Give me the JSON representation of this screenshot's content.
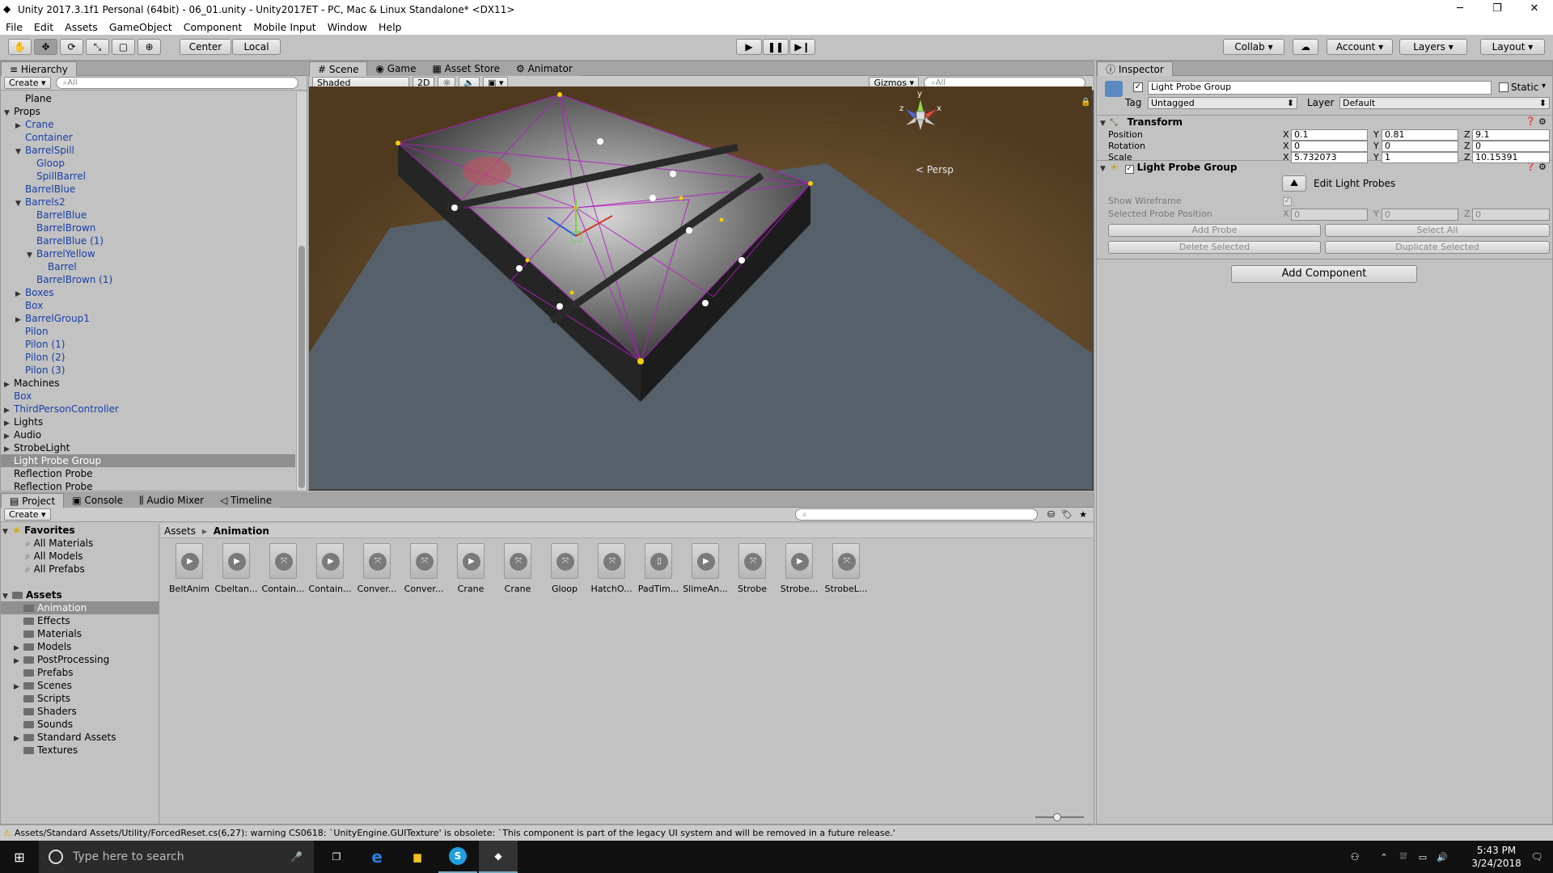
{
  "window": {
    "title": "Unity 2017.3.1f1 Personal (64bit) - 06_01.unity - Unity2017ET - PC, Mac & Linux Standalone* <DX11>"
  },
  "menu": [
    "File",
    "Edit",
    "Assets",
    "GameObject",
    "Component",
    "Mobile Input",
    "Window",
    "Help"
  ],
  "toolbar": {
    "pivot": "Center",
    "space": "Local",
    "collab": "Collab",
    "account": "Account",
    "layers": "Layers",
    "layout": "Layout"
  },
  "hierarchy": {
    "tab": "Hierarchy",
    "create": "Create",
    "search": "All",
    "items": [
      {
        "label": "Plane",
        "indent": 2,
        "blue": false,
        "arrow": ""
      },
      {
        "label": "Props",
        "indent": 1,
        "blue": false,
        "arrow": "▼"
      },
      {
        "label": "Crane",
        "indent": 2,
        "blue": true,
        "arrow": "▶"
      },
      {
        "label": "Container",
        "indent": 2,
        "blue": true,
        "arrow": ""
      },
      {
        "label": "BarrelSpill",
        "indent": 2,
        "blue": true,
        "arrow": "▼"
      },
      {
        "label": "Gloop",
        "indent": 3,
        "blue": true,
        "arrow": ""
      },
      {
        "label": "SpillBarrel",
        "indent": 3,
        "blue": true,
        "arrow": ""
      },
      {
        "label": "BarrelBlue",
        "indent": 2,
        "blue": true,
        "arrow": ""
      },
      {
        "label": "Barrels2",
        "indent": 2,
        "blue": true,
        "arrow": "▼"
      },
      {
        "label": "BarrelBlue",
        "indent": 3,
        "blue": true,
        "arrow": ""
      },
      {
        "label": "BarrelBrown",
        "indent": 3,
        "blue": true,
        "arrow": ""
      },
      {
        "label": "BarrelBlue (1)",
        "indent": 3,
        "blue": true,
        "arrow": ""
      },
      {
        "label": "BarrelYellow",
        "indent": 3,
        "blue": true,
        "arrow": "▼"
      },
      {
        "label": "Barrel",
        "indent": 4,
        "blue": true,
        "arrow": ""
      },
      {
        "label": "BarrelBrown (1)",
        "indent": 3,
        "blue": true,
        "arrow": ""
      },
      {
        "label": "Boxes",
        "indent": 2,
        "blue": true,
        "arrow": "▶"
      },
      {
        "label": "Box",
        "indent": 2,
        "blue": true,
        "arrow": ""
      },
      {
        "label": "BarrelGroup1",
        "indent": 2,
        "blue": true,
        "arrow": "▶"
      },
      {
        "label": "Pilon",
        "indent": 2,
        "blue": true,
        "arrow": ""
      },
      {
        "label": "Pilon (1)",
        "indent": 2,
        "blue": true,
        "arrow": ""
      },
      {
        "label": "Pilon (2)",
        "indent": 2,
        "blue": true,
        "arrow": ""
      },
      {
        "label": "Pilon (3)",
        "indent": 2,
        "blue": true,
        "arrow": ""
      },
      {
        "label": "Machines",
        "indent": 1,
        "blue": false,
        "arrow": "▶"
      },
      {
        "label": "Box",
        "indent": 1,
        "blue": true,
        "arrow": ""
      },
      {
        "label": "ThirdPersonController",
        "indent": 1,
        "blue": true,
        "arrow": "▶"
      },
      {
        "label": "Lights",
        "indent": 1,
        "blue": false,
        "arrow": "▶"
      },
      {
        "label": "Audio",
        "indent": 1,
        "blue": false,
        "arrow": "▶"
      },
      {
        "label": "StrobeLight",
        "indent": 1,
        "blue": false,
        "arrow": "▶"
      },
      {
        "label": "Light Probe Group",
        "indent": 1,
        "blue": false,
        "arrow": "",
        "selected": true
      },
      {
        "label": "Reflection Probe",
        "indent": 1,
        "blue": false,
        "arrow": ""
      },
      {
        "label": "Reflection Probe",
        "indent": 1,
        "blue": false,
        "arrow": ""
      }
    ]
  },
  "scene": {
    "tabs": [
      "Scene",
      "Game",
      "Asset Store",
      "Animator"
    ],
    "shading": "Shaded",
    "mode2d": "2D",
    "gizmos": "Gizmos",
    "search": "All",
    "persp": "Persp",
    "gizmo_axes": {
      "y": "y",
      "x": "x",
      "z": "z"
    }
  },
  "inspector": {
    "tab": "Inspector",
    "name": "Light Probe Group",
    "static": "Static",
    "tag_label": "Tag",
    "tag": "Untagged",
    "layer_label": "Layer",
    "layer": "Default",
    "transform": {
      "title": "Transform",
      "rows": [
        {
          "label": "Position",
          "x": "0.1",
          "y": "0.81",
          "z": "9.1"
        },
        {
          "label": "Rotation",
          "x": "0",
          "y": "0",
          "z": "0"
        },
        {
          "label": "Scale",
          "x": "5.732073",
          "y": "1",
          "z": "10.15391"
        }
      ]
    },
    "lpg": {
      "title": "Light Probe Group",
      "edit": "Edit Light Probes",
      "show_wireframe": "Show Wireframe",
      "selected_pos": "Selected Probe Position",
      "spx": "0",
      "spy": "0",
      "spz": "0",
      "add_probe": "Add Probe",
      "select_all": "Select All",
      "delete_selected": "Delete Selected",
      "duplicate_selected": "Duplicate Selected"
    },
    "add_component": "Add Component",
    "axis": {
      "x": "X",
      "y": "Y",
      "z": "Z"
    }
  },
  "project": {
    "tabs": [
      "Project",
      "Console",
      "Audio Mixer",
      "Timeline"
    ],
    "create": "Create",
    "favorites_label": "Favorites",
    "favorites": [
      "All Materials",
      "All Models",
      "All Prefabs"
    ],
    "assets_label": "Assets",
    "folders": [
      {
        "label": "Animation",
        "arrow": "",
        "selected": true
      },
      {
        "label": "Effects",
        "arrow": ""
      },
      {
        "label": "Materials",
        "arrow": ""
      },
      {
        "label": "Models",
        "arrow": "▶"
      },
      {
        "label": "PostProcessing",
        "arrow": "▶"
      },
      {
        "label": "Prefabs",
        "arrow": ""
      },
      {
        "label": "Scenes",
        "arrow": "▶"
      },
      {
        "label": "Scripts",
        "arrow": ""
      },
      {
        "label": "Shaders",
        "arrow": ""
      },
      {
        "label": "Sounds",
        "arrow": ""
      },
      {
        "label": "Standard Assets",
        "arrow": "▶"
      },
      {
        "label": "Textures",
        "arrow": ""
      }
    ],
    "breadcrumb": {
      "root": "Assets",
      "sep": "▸",
      "current": "Animation"
    },
    "items": [
      {
        "label": "BeltAnim",
        "kind": "clip"
      },
      {
        "label": "Cbeltan...",
        "kind": "clip"
      },
      {
        "label": "Contain...",
        "kind": "ctrl"
      },
      {
        "label": "Contain...",
        "kind": "clip"
      },
      {
        "label": "Conver...",
        "kind": "ctrl"
      },
      {
        "label": "Conver...",
        "kind": "ctrl"
      },
      {
        "label": "Crane",
        "kind": "clip"
      },
      {
        "label": "Crane",
        "kind": "ctrl"
      },
      {
        "label": "Gloop",
        "kind": "ctrl"
      },
      {
        "label": "HatchO...",
        "kind": "ctrl"
      },
      {
        "label": "PadTim...",
        "kind": "timeline"
      },
      {
        "label": "SlimeAn...",
        "kind": "clip"
      },
      {
        "label": "Strobe",
        "kind": "ctrl"
      },
      {
        "label": "Strobe...",
        "kind": "clip"
      },
      {
        "label": "StrobeL...",
        "kind": "ctrl"
      }
    ]
  },
  "status": {
    "message": "Assets/Standard Assets/Utility/ForcedReset.cs(6,27): warning CS0618: `UnityEngine.GUITexture' is obsolete: `This component is part of the legacy UI system and will be removed in a future release.'"
  },
  "taskbar": {
    "search": "Type here to search",
    "time": "5:43 PM",
    "date": "3/24/2018"
  }
}
